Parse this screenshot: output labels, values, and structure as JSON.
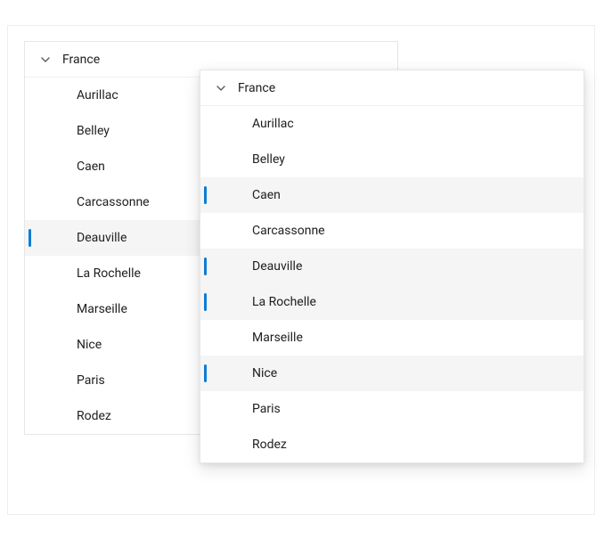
{
  "colors": {
    "accent": "#0c7cd5",
    "selected_bg": "#f5f5f5",
    "border": "#e6e6e6"
  },
  "tree_a": {
    "header": "France",
    "items": [
      {
        "label": "Aurillac",
        "selected": false
      },
      {
        "label": "Belley",
        "selected": false
      },
      {
        "label": "Caen",
        "selected": false
      },
      {
        "label": "Carcassonne",
        "selected": false
      },
      {
        "label": "Deauville",
        "selected": true
      },
      {
        "label": "La Rochelle",
        "selected": false
      },
      {
        "label": "Marseille",
        "selected": false
      },
      {
        "label": "Nice",
        "selected": false
      },
      {
        "label": "Paris",
        "selected": false
      },
      {
        "label": "Rodez",
        "selected": false
      }
    ]
  },
  "tree_b": {
    "header": "France",
    "items": [
      {
        "label": "Aurillac",
        "selected": false
      },
      {
        "label": "Belley",
        "selected": false
      },
      {
        "label": "Caen",
        "selected": true
      },
      {
        "label": "Carcassonne",
        "selected": false
      },
      {
        "label": "Deauville",
        "selected": true
      },
      {
        "label": "La Rochelle",
        "selected": true
      },
      {
        "label": "Marseille",
        "selected": false
      },
      {
        "label": "Nice",
        "selected": true
      },
      {
        "label": "Paris",
        "selected": false
      },
      {
        "label": "Rodez",
        "selected": false
      }
    ]
  }
}
